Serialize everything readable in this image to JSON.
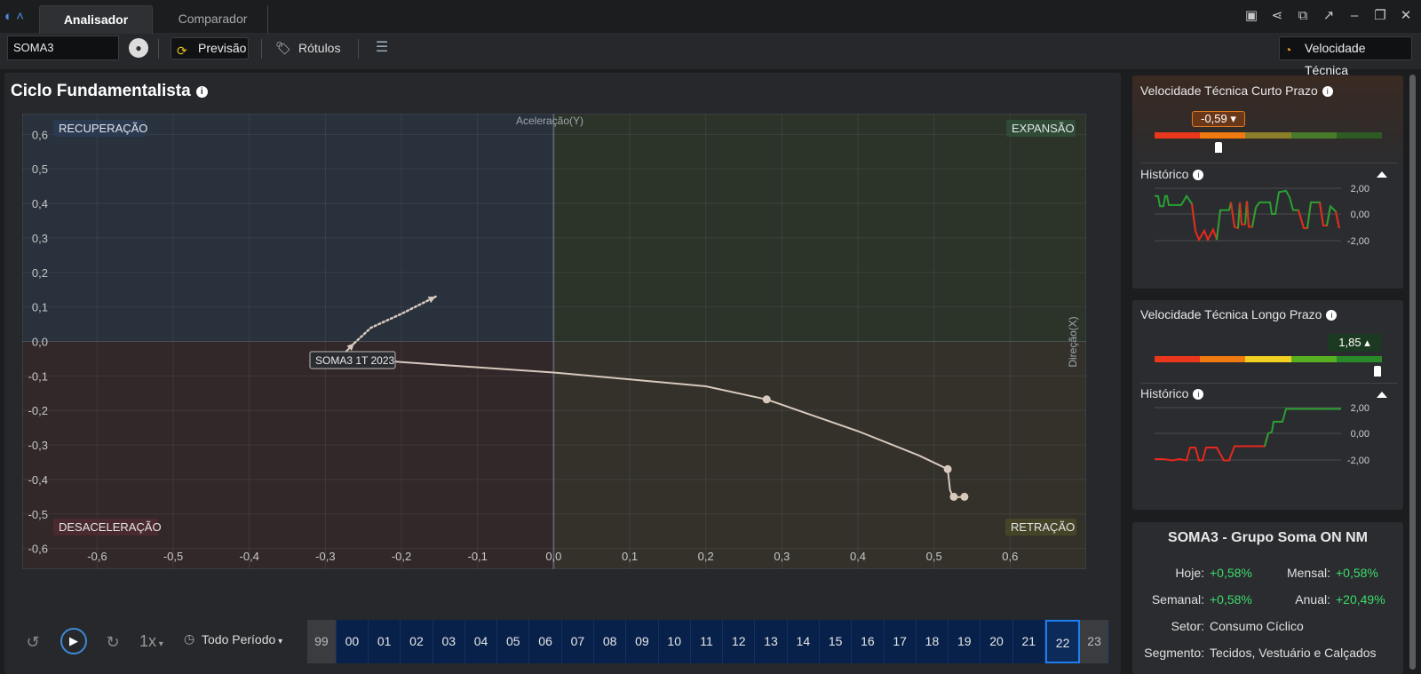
{
  "app": {
    "tabs": [
      {
        "label": "Analisador",
        "active": true
      },
      {
        "label": "Comparador",
        "active": false
      }
    ],
    "window_icons": [
      "present-icon",
      "share-icon",
      "popout-icon",
      "trend-icon",
      "minimize-icon",
      "restore-icon",
      "close-icon"
    ]
  },
  "toolbar": {
    "ticker_value": "SOMA3",
    "forecast_label": "Previsão",
    "labels_label": "Rótulos",
    "technical_velocity_label": "Velocidade Técnica"
  },
  "cycle": {
    "title": "Ciclo Fundamentalista",
    "quadrants": {
      "top_left": "RECUPERAÇÃO",
      "top_right": "EXPANSÃO",
      "bottom_left": "DESACELERAÇÃO",
      "bottom_right": "RETRAÇÃO"
    },
    "colors": {
      "recovery": "#28313c",
      "expansion": "#2c3329",
      "deceleration": "#32282a",
      "retraction": "#33312a",
      "line": "#d8c9bd"
    },
    "axis_y_title": "Aceleração(Y)",
    "axis_x_title": "Direção(X)",
    "point_label": "SOMA3 1T 2023"
  },
  "chart_data": {
    "type": "scatter",
    "x_ticks": [
      "-0,6",
      "-0,5",
      "-0,4",
      "-0,3",
      "-0,2",
      "-0,1",
      "0,0",
      "0,1",
      "0,2",
      "0,3",
      "0,4",
      "0,5",
      "0,6"
    ],
    "y_ticks": [
      "0,6",
      "0,5",
      "0,4",
      "0,3",
      "0,2",
      "0,1",
      "0,0",
      "-0,1",
      "-0,2",
      "-0,3",
      "-0,4",
      "-0,5",
      "-0,6"
    ],
    "xlim": [
      -0.66,
      0.7
    ],
    "ylim": [
      -0.66,
      0.66
    ],
    "series": [
      {
        "style": "solid",
        "points": [
          [
            0.54,
            -0.45
          ],
          [
            0.525,
            -0.452
          ],
          [
            0.521,
            -0.43
          ],
          [
            0.518,
            -0.37
          ],
          [
            0.48,
            -0.33
          ],
          [
            0.4,
            -0.26
          ],
          [
            0.28,
            -0.168
          ],
          [
            0.2,
            -0.13
          ],
          [
            0.0,
            -0.09
          ],
          [
            -0.2,
            -0.06
          ],
          [
            -0.28,
            -0.045
          ],
          [
            -0.262,
            -0.005
          ]
        ]
      },
      {
        "style": "dotted",
        "points": [
          [
            -0.262,
            -0.005
          ],
          [
            -0.24,
            0.04
          ],
          [
            -0.2,
            0.08
          ],
          [
            -0.155,
            0.13
          ]
        ]
      }
    ],
    "marked_points": [
      [
        0.28,
        -0.168
      ],
      [
        0.518,
        -0.37
      ],
      [
        0.526,
        -0.45
      ],
      [
        0.54,
        -0.45
      ]
    ]
  },
  "timeline": {
    "speed_label": "1x",
    "period_label": "Todo Período",
    "years": [
      "99",
      "00",
      "01",
      "02",
      "03",
      "04",
      "05",
      "06",
      "07",
      "08",
      "09",
      "10",
      "11",
      "12",
      "13",
      "14",
      "15",
      "16",
      "17",
      "18",
      "19",
      "20",
      "21",
      "22",
      "23"
    ],
    "selected_year": "22"
  },
  "short_term": {
    "title": "Velocidade Técnica Curto Prazo",
    "value": "-0,59",
    "level": 0.28,
    "history_label": "Histórico",
    "y_ticks": [
      "2,00",
      "0,00",
      "-2,00"
    ],
    "gauge_colors": [
      "#e8371c",
      "#f07a10",
      "#8c7f2a",
      "#477a2a",
      "#2e5a24"
    ]
  },
  "long_term": {
    "title": "Velocidade Técnica Longo Prazo",
    "value": "1,85",
    "level": 0.98,
    "history_label": "Histórico",
    "y_ticks": [
      "2,00",
      "0,00",
      "-2,00"
    ],
    "gauge_colors": [
      "#e8371c",
      "#f07a10",
      "#f0d020",
      "#58b020",
      "#2a8a2a"
    ]
  },
  "asset_info": {
    "title": "SOMA3 - Grupo Soma ON NM",
    "rows": [
      {
        "k": "Hoje:",
        "v": "+0,58%"
      },
      {
        "k": "Mensal:",
        "v": "+0,58%"
      },
      {
        "k": "Semanal:",
        "v": "+0,58%"
      },
      {
        "k": "Anual:",
        "v": "+20,49%"
      }
    ],
    "sector_k": "Setor:",
    "sector_v": "Consumo Cíclico",
    "segment_k": "Segmento:",
    "segment_v": "Tecidos, Vestuário e Calçados"
  }
}
